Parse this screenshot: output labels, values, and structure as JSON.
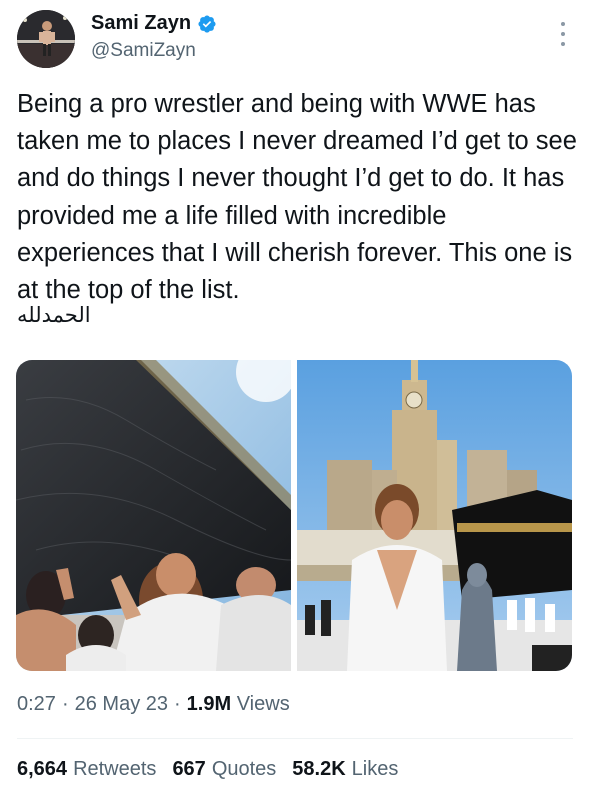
{
  "user": {
    "display_name": "Sami Zayn",
    "handle": "@SamiZayn",
    "verified": true,
    "verified_color": "#1d9bf0"
  },
  "tweet": {
    "text": "Being a pro wrestler and being with WWE has taken me to places I never dreamed I’d get to see and do things I never thought I’d get to do. It has provided me a life filled with incredible experiences that I will cherish forever. This one is at the top of the list.",
    "arabic": "الحمدلله"
  },
  "media": [
    {
      "name": "kaaba-closeup-photo"
    },
    {
      "name": "makkah-clock-tower-photo"
    }
  ],
  "meta": {
    "time": "0:27",
    "sep1": "·",
    "date": "26 May 23",
    "sep2": "·",
    "views_count": "1.9M",
    "views_label": "Views"
  },
  "stats": {
    "retweets_count": "6,664",
    "retweets_label": "Retweets",
    "quotes_count": "667",
    "quotes_label": "Quotes",
    "likes_count": "58.2K",
    "likes_label": "Likes"
  },
  "colors": {
    "text_primary": "#0f1419",
    "text_secondary": "#536471",
    "divider": "#eff3f4"
  }
}
